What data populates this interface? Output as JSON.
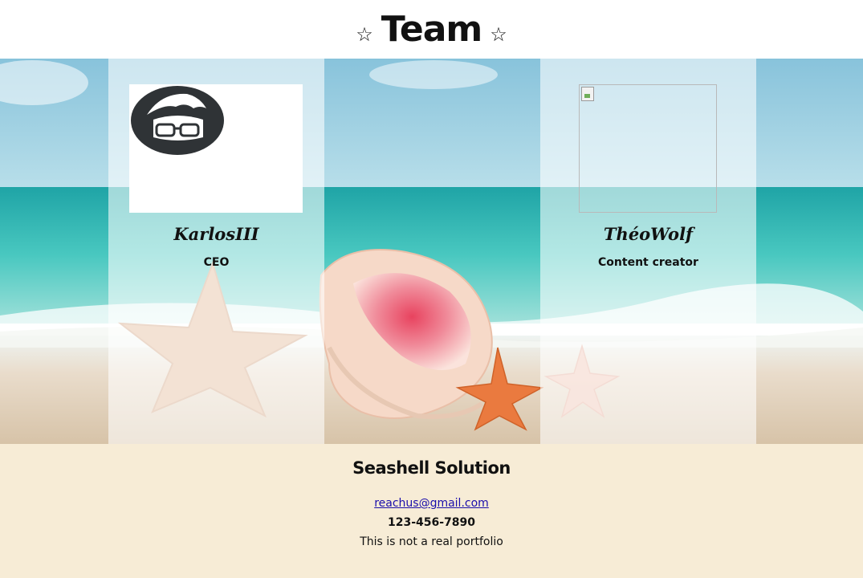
{
  "header": {
    "title": "Team",
    "star_glyph": "☆"
  },
  "team": {
    "members": [
      {
        "name": "KarlosIII",
        "role": "CEO",
        "photo": "avatar-glasses-icon"
      },
      {
        "name": "ThéoWolf",
        "role": "Content creator",
        "photo": "broken-image-icon"
      }
    ]
  },
  "footer": {
    "company": "Seashell Solution",
    "email": "reachus@gmail.com",
    "phone": "123-456-7890",
    "disclaimer": "This is not a real portfolio"
  },
  "colors": {
    "footer_bg": "#f7ecd6",
    "link": "#1a0dab",
    "sea": "#33b9b3",
    "sky": "#8fc8dc"
  }
}
